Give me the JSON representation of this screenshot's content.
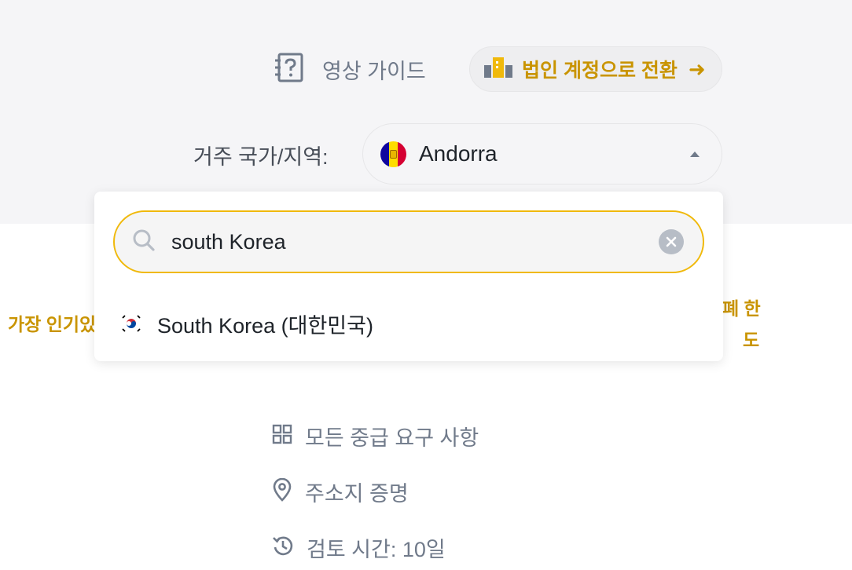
{
  "header": {
    "guide_label": "영상 가이드",
    "corporate_button_label": "법인 계정으로 전환",
    "corporate_arrow": "➜"
  },
  "residence": {
    "label": "거주 국가/지역:",
    "selected_country": "Andorra",
    "selected_flag_icon": "andorra-flag-icon"
  },
  "dropdown": {
    "search": {
      "value": "south Korea",
      "placeholder": ""
    },
    "options": [
      {
        "label": "South Korea (대한민국)",
        "flag_icon": "south-korea-flag-icon"
      }
    ]
  },
  "background_text": {
    "left_partial": "가장 인기있",
    "right_partial_line1": "폐 한",
    "right_partial_line2": "도"
  },
  "requirements": [
    {
      "icon": "grid-icon",
      "label": "모든 중급 요구 사항"
    },
    {
      "icon": "location-pin-icon",
      "label": "주소지 증명"
    },
    {
      "icon": "clock-history-icon",
      "label": "검토 시간: 10일"
    }
  ],
  "colors": {
    "accent": "#f0b90b",
    "accent_text": "#c99400",
    "muted_text": "#707a8a",
    "background_band": "#f5f5f7"
  }
}
